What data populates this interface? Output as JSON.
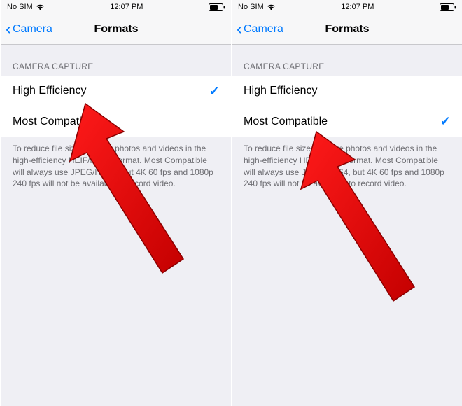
{
  "status": {
    "carrier": "No SIM",
    "time": "12:07 PM"
  },
  "nav": {
    "back_label": "Camera",
    "title": "Formats"
  },
  "section": {
    "header": "CAMERA CAPTURE",
    "option_high_efficiency": "High Efficiency",
    "option_most_compatible": "Most Compatible",
    "footer": "To reduce file size, capture photos and videos in the high-efficiency HEIF/HEVC format. Most Compatible will always use JPEG/H.264, but 4K 60 fps and 1080p 240 fps will not be available to record video."
  },
  "left_screen": {
    "selected": "high_efficiency"
  },
  "right_screen": {
    "selected": "most_compatible"
  }
}
